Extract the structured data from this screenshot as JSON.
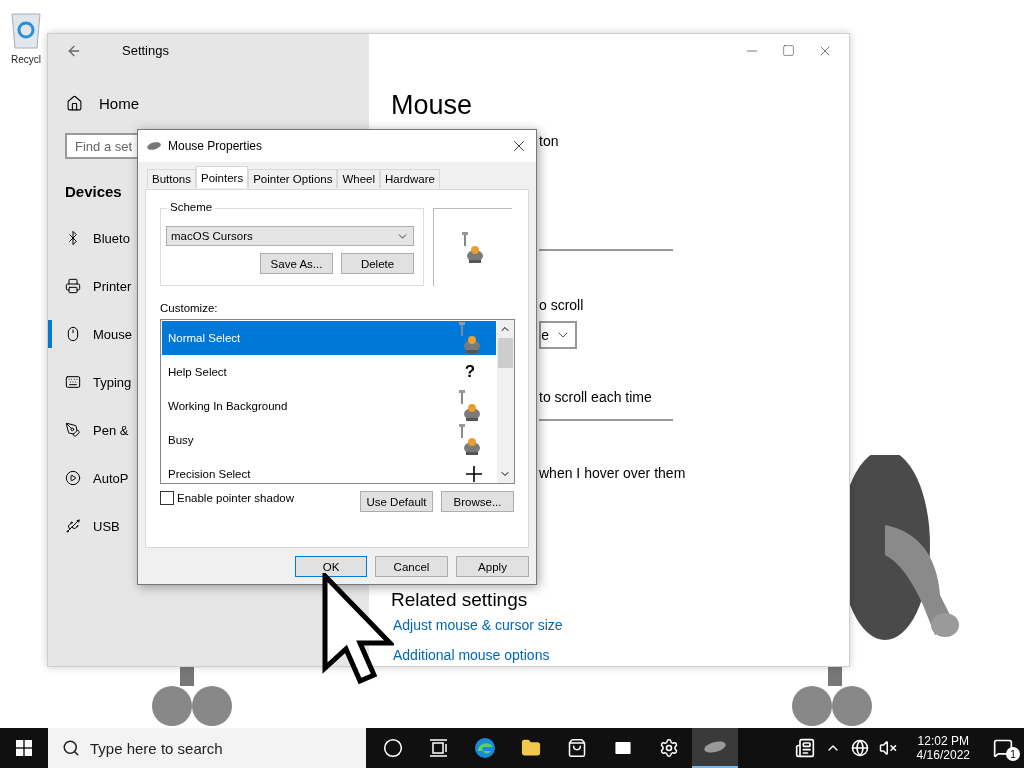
{
  "desktop": {
    "icons": [
      {
        "label": "Recycl"
      }
    ]
  },
  "settings_window": {
    "title": "Settings",
    "nav": {
      "home": "Home",
      "search": {
        "placeholder": "Find a set"
      },
      "section": "Devices",
      "items": [
        {
          "label": "Blueto",
          "kind": "bluetooth",
          "selected": false
        },
        {
          "label": "Printer",
          "kind": "printer",
          "selected": false
        },
        {
          "label": "Mouse",
          "kind": "mouse",
          "selected": true
        },
        {
          "label": "Typing",
          "kind": "keyboard",
          "selected": false
        },
        {
          "label": "Pen &",
          "kind": "pen",
          "selected": false
        },
        {
          "label": "AutoP",
          "kind": "autoplay",
          "selected": false
        },
        {
          "label": "USB",
          "kind": "usb",
          "selected": false
        }
      ]
    },
    "content": {
      "heading": "Mouse",
      "fragments": [
        {
          "kind": "text",
          "text": "ton"
        },
        {
          "kind": "rule"
        },
        {
          "kind": "text",
          "text": "o scroll"
        },
        {
          "kind": "dropdown",
          "text": "e"
        },
        {
          "kind": "text",
          "text": "to scroll each time"
        },
        {
          "kind": "rule"
        },
        {
          "kind": "text",
          "text": "when I hover over them"
        }
      ],
      "related_title": "Related settings",
      "links": [
        "Adjust mouse & cursor size",
        "Additional mouse options"
      ]
    }
  },
  "dialog": {
    "title": "Mouse Properties",
    "tabs": [
      {
        "label": "Buttons",
        "selected": false
      },
      {
        "label": "Pointers",
        "selected": true
      },
      {
        "label": "Pointer Options",
        "selected": false
      },
      {
        "label": "Wheel",
        "selected": false
      },
      {
        "label": "Hardware",
        "selected": false
      }
    ],
    "scheme": {
      "label": "Scheme",
      "value": "macOS Cursors",
      "buttons": [
        "Save As...",
        "Delete"
      ]
    },
    "customize_label": "Customize:",
    "cursors": [
      {
        "label": "Normal Select",
        "kind": "figure",
        "selected": true
      },
      {
        "label": "Help Select",
        "kind": "glyph",
        "glyph": "?",
        "selected": false
      },
      {
        "label": "Working In Background",
        "kind": "figure",
        "selected": false
      },
      {
        "label": "Busy",
        "kind": "figure",
        "selected": false
      },
      {
        "label": "Precision Select",
        "kind": "cross",
        "selected": false
      }
    ],
    "shadow": {
      "label": "Enable pointer shadow",
      "checked": false
    },
    "list_buttons": [
      "Use Default",
      "Browse..."
    ],
    "footer_buttons": [
      {
        "label": "OK",
        "default": true
      },
      {
        "label": "Cancel",
        "default": false
      },
      {
        "label": "Apply",
        "default": false
      }
    ]
  },
  "taskbar": {
    "search": {
      "placeholder": "Type here to search"
    },
    "apps": [
      {
        "kind": "cortana",
        "selected": false
      },
      {
        "kind": "taskview",
        "selected": false
      },
      {
        "kind": "edge",
        "selected": false
      },
      {
        "kind": "explorer",
        "selected": false
      },
      {
        "kind": "store",
        "selected": false
      },
      {
        "kind": "mail",
        "selected": false
      },
      {
        "kind": "settings",
        "selected": false
      },
      {
        "kind": "mouse",
        "selected": true
      }
    ],
    "time": "12:02 PM",
    "date": "4/16/2022",
    "notifications": "1"
  }
}
